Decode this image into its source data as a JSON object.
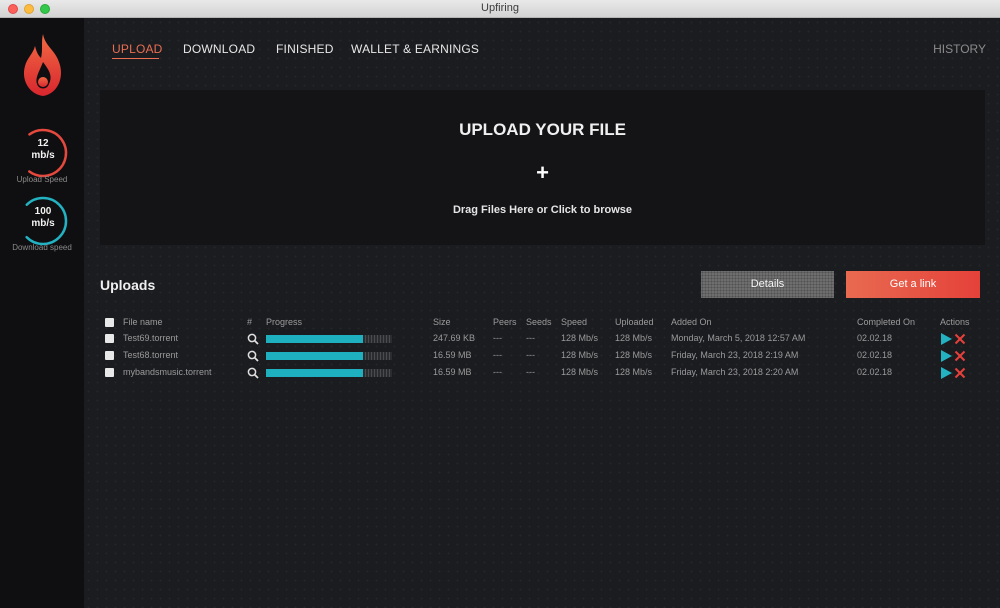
{
  "window": {
    "title": "Upfiring"
  },
  "sidebar": {
    "upload_gauge": {
      "value": "12",
      "unit": "mb/s",
      "label": "Upload Speed",
      "level": 0.7,
      "color": "#e5483d"
    },
    "download_gauge": {
      "value": "100",
      "unit": "mb/s",
      "label": "Download speed",
      "level": 0.75,
      "color": "#22b2c2"
    }
  },
  "nav": {
    "tabs": [
      {
        "label": "UPLOAD",
        "active": true
      },
      {
        "label": "DOWNLOAD"
      },
      {
        "label": "FINISHED"
      },
      {
        "label": "WALLET & EARNINGS"
      }
    ],
    "history": "HISTORY"
  },
  "dropzone": {
    "title": "UPLOAD YOUR FILE",
    "plus": "+",
    "hint": "Drag Files Here or Click to browse"
  },
  "uploads": {
    "title": "Uploads",
    "details_button": "Details",
    "get_link_button": "Get a link",
    "columns": [
      "File name",
      "#",
      "Progress",
      "Size",
      "Peers",
      "Seeds",
      "Speed",
      "Uploaded",
      "Added On",
      "Completed On",
      "Actions"
    ],
    "rows": [
      {
        "name": "Test69.torrent",
        "progress": 0.77,
        "size": "247.69 KB",
        "peers": "---",
        "seeds": "---",
        "speed": "128 Mb/s",
        "uploaded": "128 Mb/s",
        "added": "Monday, March 5, 2018 12:57 AM",
        "completed": "02.02.18"
      },
      {
        "name": "Test68.torrent",
        "progress": 0.77,
        "size": "16.59 MB",
        "peers": "---",
        "seeds": "---",
        "speed": "128 Mb/s",
        "uploaded": "128 Mb/s",
        "added": "Friday, March 23, 2018 2:19 AM",
        "completed": "02.02.18"
      },
      {
        "name": "mybandsmusic.torrent",
        "progress": 0.77,
        "size": "16.59 MB",
        "peers": "---",
        "seeds": "---",
        "speed": "128 Mb/s",
        "uploaded": "128 Mb/s",
        "added": "Friday, March 23, 2018 2:20 AM",
        "completed": "02.02.18"
      }
    ]
  },
  "colors": {
    "accent": "#e96e52",
    "progress": "#1fb0bf",
    "danger": "#e5413a"
  }
}
